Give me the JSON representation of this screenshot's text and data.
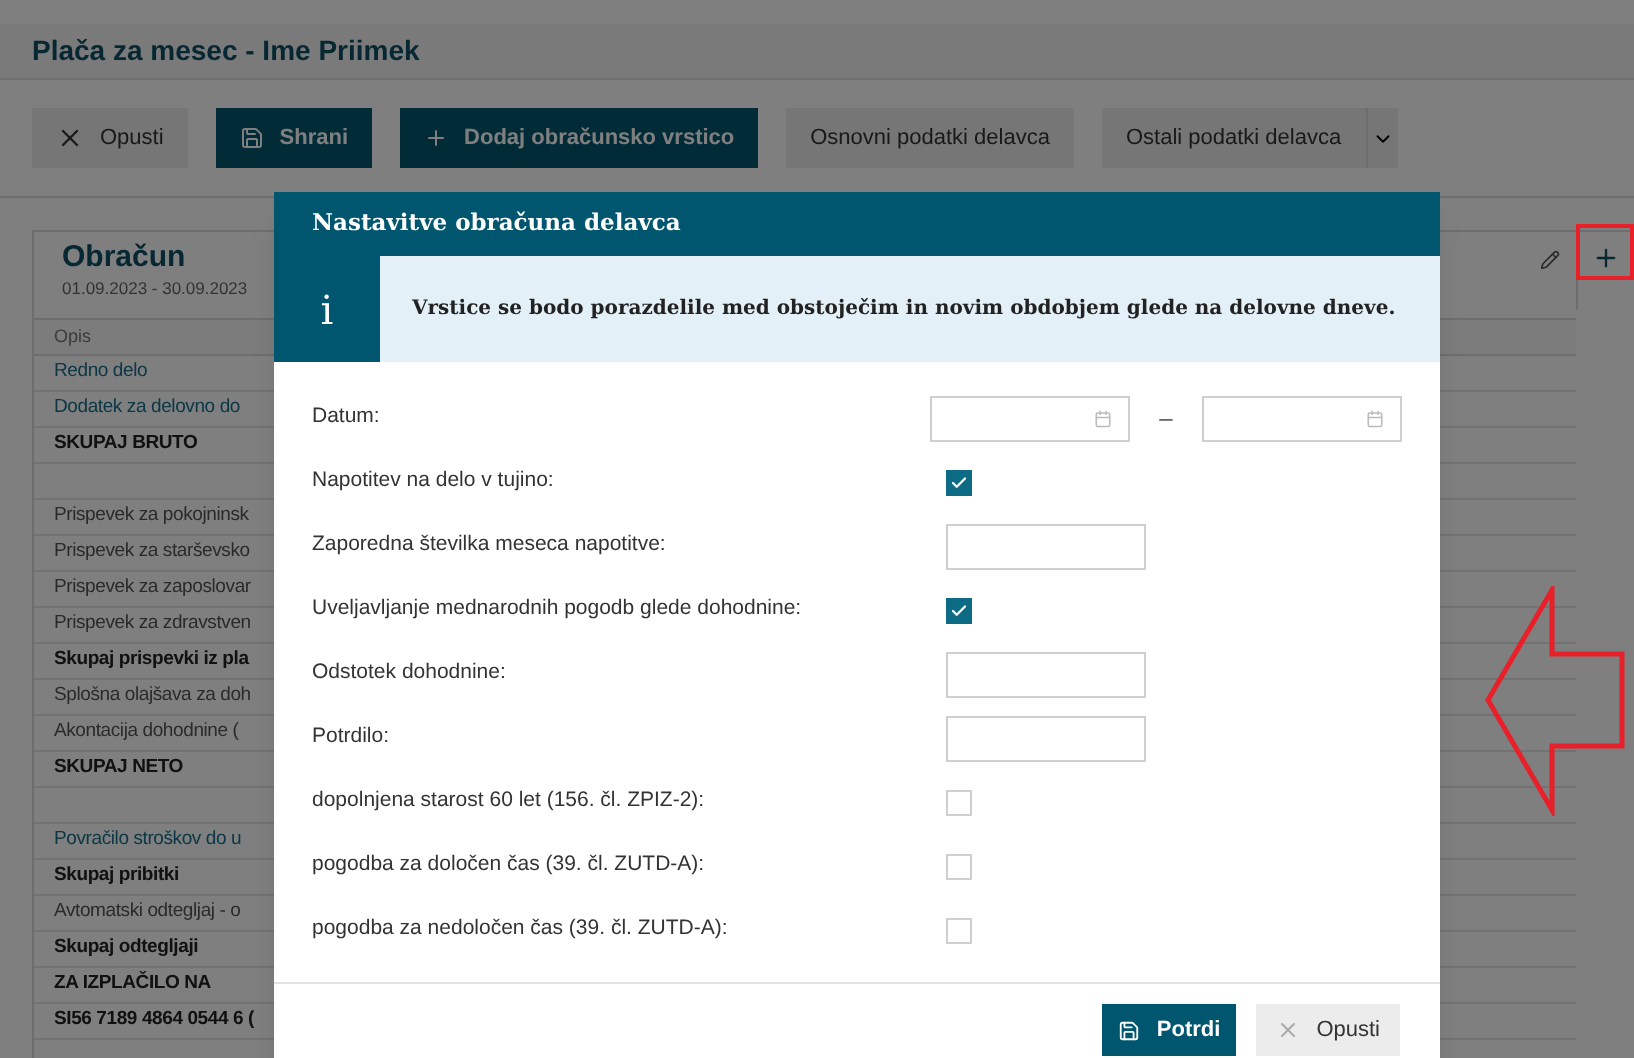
{
  "page": {
    "title": "Plača za mesec - Ime Priimek"
  },
  "toolbar": [
    {
      "label": "Opusti",
      "kind": "close"
    },
    {
      "label": "Shrani",
      "kind": "save"
    },
    {
      "label": "Dodaj obračunsko vrstico",
      "kind": "add"
    },
    {
      "label": "Osnovni podatki delavca",
      "kind": "plain"
    },
    {
      "label": "Ostali podatki delavca",
      "kind": "dropdown"
    }
  ],
  "tab": {
    "title": "Obračun",
    "period": "01.09.2023 - 30.09.2023"
  },
  "table": {
    "columns": [
      "Opis"
    ],
    "rows": [
      {
        "text": "Redno delo",
        "kind": "link"
      },
      {
        "text": "Dodatek za delovno do",
        "kind": "link"
      },
      {
        "text": "SKUPAJ BRUTO",
        "kind": "bold"
      },
      {
        "text": "",
        "kind": "blank"
      },
      {
        "text": "Prispevek za pokojninsk",
        "kind": "plain"
      },
      {
        "text": "Prispevek za starševsko",
        "kind": "plain"
      },
      {
        "text": "Prispevek za zaposlovar",
        "kind": "plain"
      },
      {
        "text": "Prispevek za zdravstven",
        "kind": "plain"
      },
      {
        "text": "Skupaj prispevki iz pla",
        "kind": "bold"
      },
      {
        "text": "Splošna olajšava za doh",
        "kind": "plain"
      },
      {
        "text": "Akontacija dohodnine (",
        "kind": "plain"
      },
      {
        "text": "SKUPAJ NETO",
        "kind": "bold"
      },
      {
        "text": "",
        "kind": "blank"
      },
      {
        "text": "Povračilo stroškov do u",
        "kind": "link"
      },
      {
        "text": "Skupaj pribitki",
        "kind": "bold"
      },
      {
        "text": "Avtomatski odtegljaj - o",
        "kind": "plain"
      },
      {
        "text": "Skupaj odtegljaji",
        "kind": "bold"
      },
      {
        "text": "ZA IZPLAČILO NA",
        "kind": "bold"
      },
      {
        "text": "SI56 7189 4864 0544 6 (",
        "kind": "bold"
      },
      {
        "text": "",
        "kind": "blank"
      }
    ]
  },
  "dialog": {
    "title": "Nastavitve obračuna delavca",
    "info_icon": "i",
    "info": "Vrstice se bodo porazdelile med obstoječim in novim obdobjem glede na delovne dneve.",
    "fields": [
      {
        "label": "Datum:",
        "kind": "date-range",
        "separator": "–"
      },
      {
        "label": "Napotitev na delo v tujino:",
        "kind": "checkbox",
        "checked": true
      },
      {
        "label": "Zaporedna številka meseca napotitve:",
        "kind": "text"
      },
      {
        "label": "Uveljavljanje mednarodnih pogodb glede dohodnine:",
        "kind": "checkbox",
        "checked": true
      },
      {
        "label": "Odstotek dohodnine:",
        "kind": "text"
      },
      {
        "label": "Potrdilo:",
        "kind": "text"
      },
      {
        "label": "dopolnjena starost 60 let (156. čl. ZPIZ-2):",
        "kind": "checkbox",
        "checked": false
      },
      {
        "label": "pogodba za določen čas (39. čl. ZUTD-A):",
        "kind": "checkbox",
        "checked": false
      },
      {
        "label": "pogodba za nedoločen čas (39. čl. ZUTD-A):",
        "kind": "checkbox",
        "checked": false
      }
    ],
    "buttons": [
      {
        "label": "Potrdi",
        "kind": "confirm"
      },
      {
        "label": "Opusti",
        "kind": "cancel"
      }
    ]
  }
}
